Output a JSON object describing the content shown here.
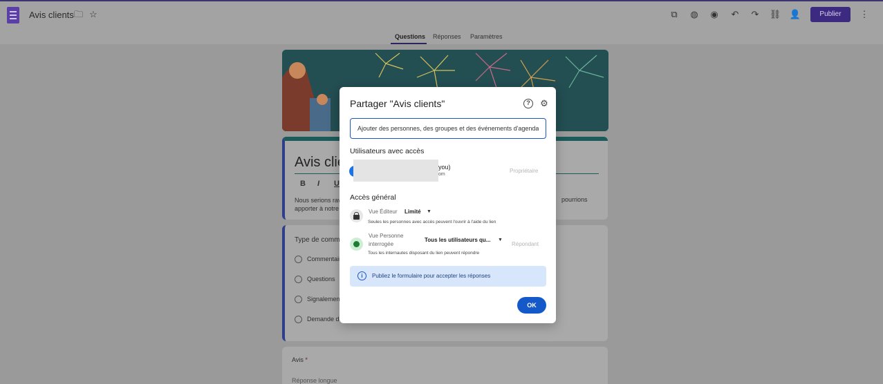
{
  "app": {
    "title": "Avis clients"
  },
  "toolbar": {
    "icons": [
      "addon-icon",
      "palette-icon",
      "preview-icon",
      "undo-icon",
      "redo-icon",
      "link-icon",
      "add-collaborator-icon",
      "more-icon"
    ],
    "publish_label": "Publier"
  },
  "tabs": [
    {
      "label": "Questions",
      "active": true
    },
    {
      "label": "Réponses",
      "active": false
    },
    {
      "label": "Paramètres",
      "active": false
    }
  ],
  "form": {
    "title_partial": "Avis clie",
    "description_left": "Nous serions ravi",
    "description_left2": "apporter à notre (",
    "description_right": "pourrions",
    "question1": {
      "title_partial": "Type de comme",
      "options": [
        "Commentair",
        "Questions",
        "Signalement",
        "Demande de"
      ]
    },
    "question2": {
      "title": "Avis",
      "required_mark": "*",
      "answer_hint": "Réponse longue"
    }
  },
  "share_dialog": {
    "title": "Partager \"Avis clients\"",
    "input_placeholder": "Ajouter des personnes, des groupes et des événements d'agenda",
    "users_section": "Utilisateurs avec accès",
    "user": {
      "name_suffix": "you)",
      "email_suffix": "om",
      "role": "Propriétaire"
    },
    "general_section": "Accès général",
    "editor_access": {
      "label": "Vue Éditeur",
      "value": "Limité",
      "description": "Seules les personnes avec accès peuvent l'ouvrir à l'aide du lien"
    },
    "respondent_access": {
      "label_line1": "Vue Personne",
      "label_line2": "interrogée",
      "value": "Tous les utilisateurs qu...",
      "role": "Répondant",
      "description": "Tous les internautes disposant du lien peuvent répondre"
    },
    "info_text": "Publiez le formulaire pour accepter les réponses",
    "ok_label": "OK"
  }
}
